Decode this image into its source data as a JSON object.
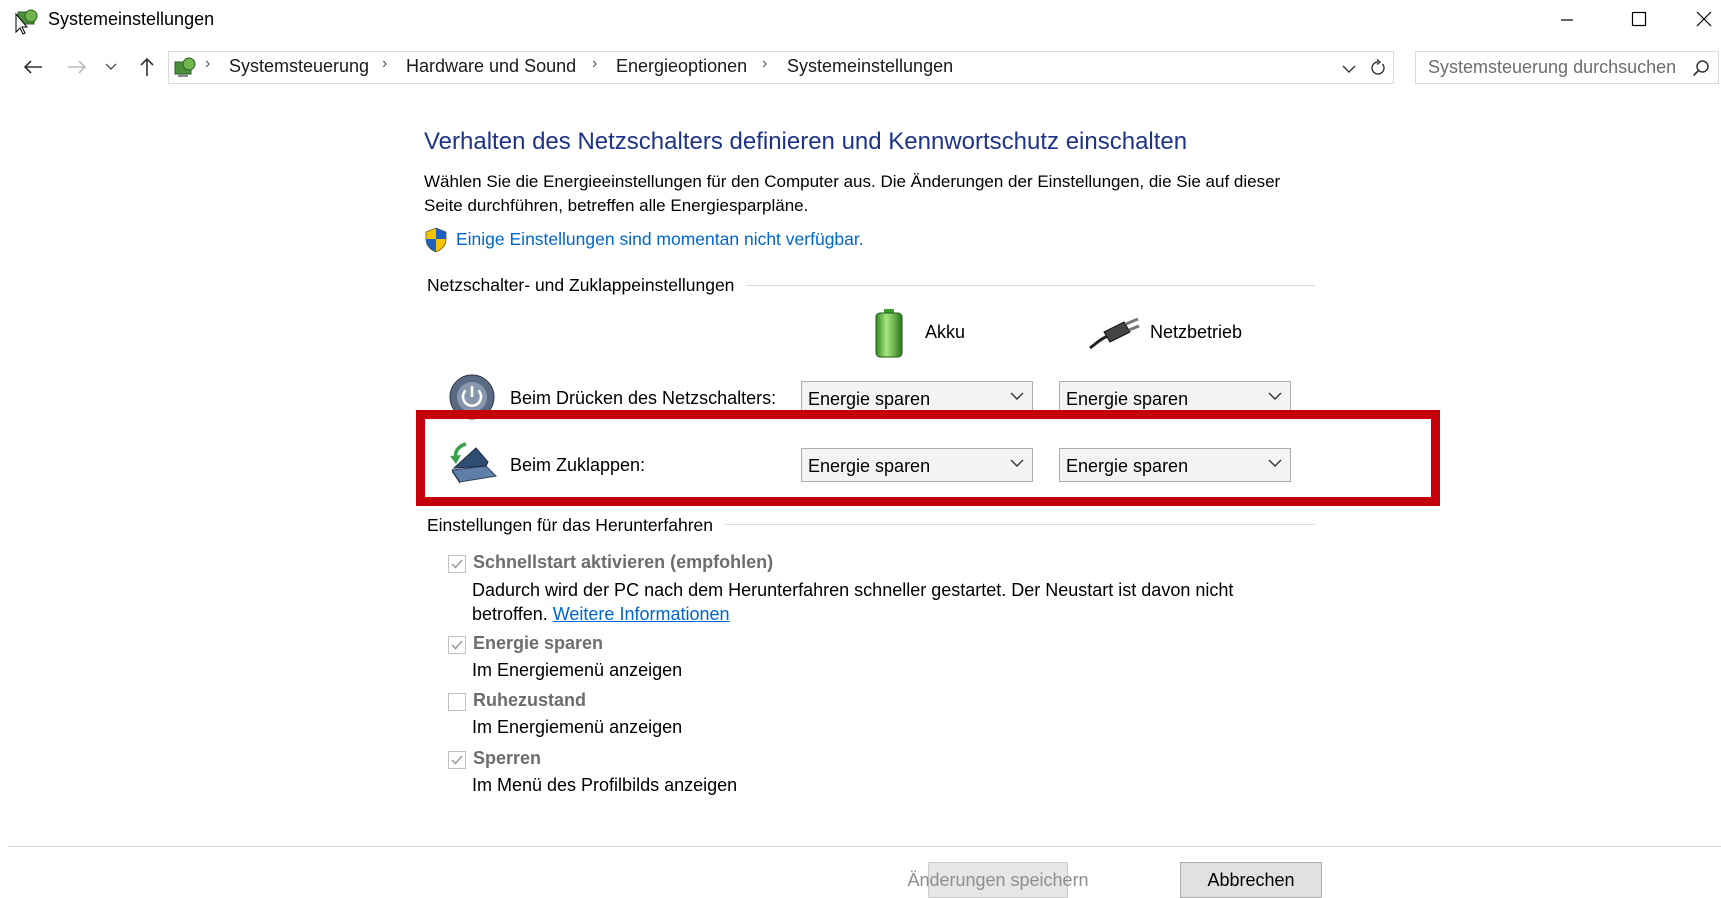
{
  "window": {
    "title": "Systemeinstellungen",
    "icon": "control-panel-icon",
    "controls": [
      "minimize-icon",
      "maximize-icon",
      "close-icon"
    ]
  },
  "addressbar": {
    "breadcrumbs": [
      "Systemsteuerung",
      "Hardware und Sound",
      "Energieoptionen",
      "Systemeinstellungen"
    ],
    "search_placeholder": "Systemsteuerung durchsuchen"
  },
  "main": {
    "heading": "Verhalten des Netzschalters definieren und Kennwortschutz einschalten",
    "intro": "Wählen Sie die Energieeinstellungen für den Computer aus. Die Änderungen der Einstellungen, die Sie auf dieser Seite durchführen, betreffen alle Energiesparpläne.",
    "notice_link": "Einige Einstellungen sind momentan nicht verfügbar.",
    "power_section": {
      "label": "Netzschalter- und Zuklappeinstellungen",
      "columns": [
        "Akku",
        "Netzbetrieb"
      ],
      "rows": [
        {
          "label": "Beim Drücken des Netzschalters:",
          "battery": "Energie sparen",
          "plugged": "Energie sparen"
        },
        {
          "label": "Beim Zuklappen:",
          "battery": "Energie sparen",
          "plugged": "Energie sparen"
        }
      ]
    },
    "shutdown_section": {
      "label": "Einstellungen für das Herunterfahren",
      "options": [
        {
          "title": "Schnellstart aktivieren (empfohlen)",
          "checked": true,
          "desc": "Dadurch wird der PC nach dem Herunterfahren schneller gestartet. Der Neustart ist davon nicht betroffen.",
          "link": "Weitere Informationen"
        },
        {
          "title": "Energie sparen",
          "checked": true,
          "desc": "Im Energiemenü anzeigen"
        },
        {
          "title": "Ruhezustand",
          "checked": false,
          "desc": "Im Energiemenü anzeigen"
        },
        {
          "title": "Sperren",
          "checked": true,
          "desc": "Im Menü des Profilbilds anzeigen"
        }
      ]
    }
  },
  "footer": {
    "save_label": "Änderungen speichern",
    "cancel_label": "Abbrechen"
  },
  "colors": {
    "heading": "#1e3287",
    "link": "#0066cc",
    "highlight": "#c4000b"
  }
}
